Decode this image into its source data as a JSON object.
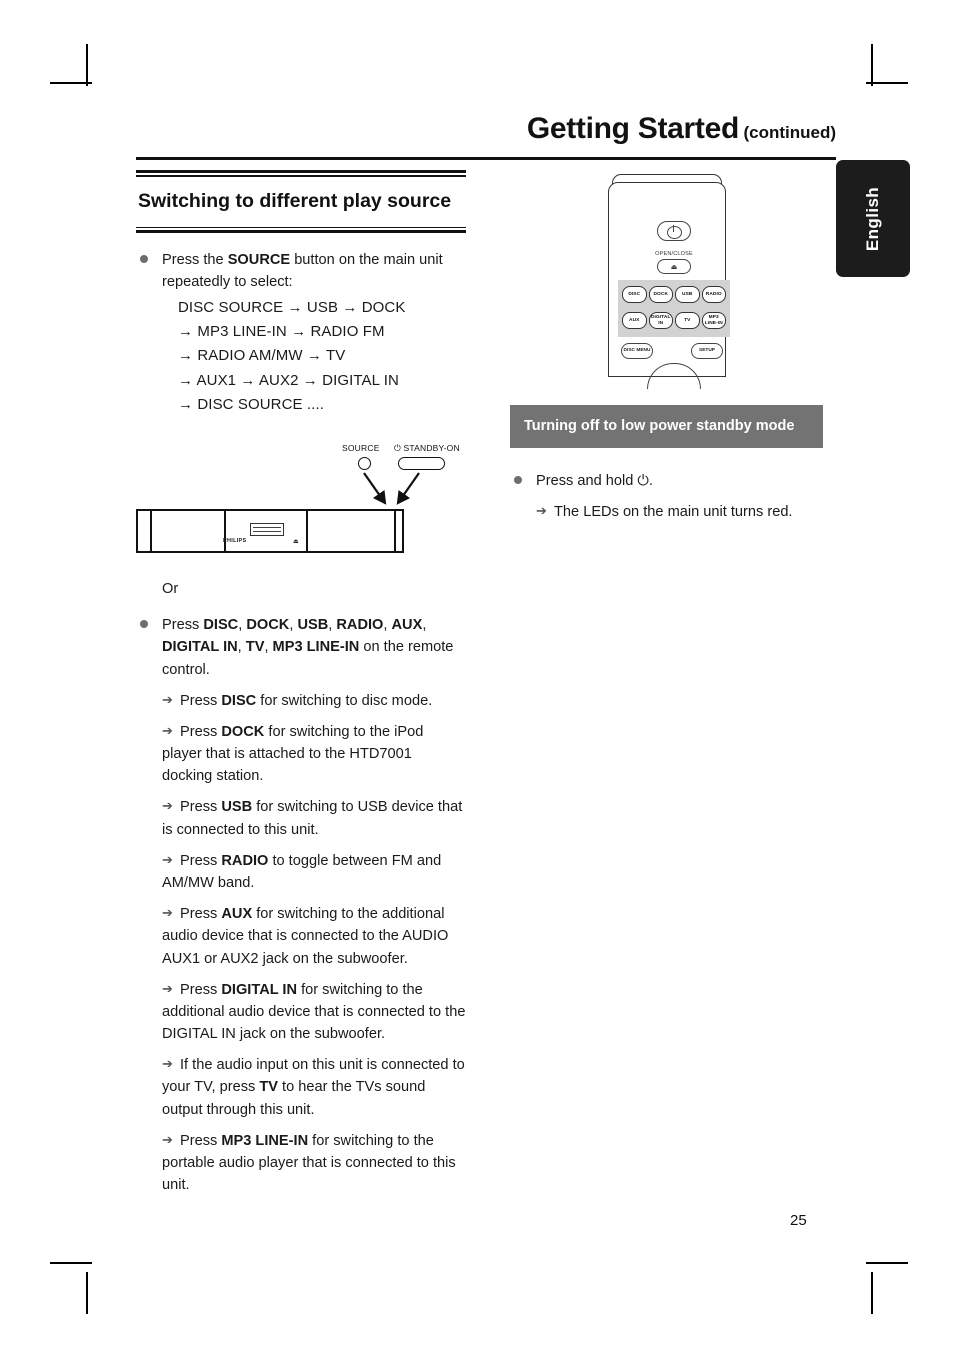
{
  "header": {
    "title": "Getting Started",
    "continued": "(continued)"
  },
  "language_tab": {
    "label": "English"
  },
  "left_column": {
    "section_heading": "Switching to different play source",
    "source_instruction_pre": "Press the ",
    "source_instruction_bold": "SOURCE",
    "source_instruction_post": " button on the main unit repeatedly to select:",
    "source_sequence": [
      "DISC SOURCE → USB → DOCK",
      "→ MP3 LINE-IN → RADIO FM",
      "→ RADIO AM/MW → TV",
      "→ AUX1 → AUX2 → DIGITAL IN",
      "→ DISC SOURCE ...."
    ],
    "unit_figure": {
      "source_label": "SOURCE",
      "standby_label": "⏻ STANDBY-ON",
      "brand": "PHILIPS",
      "eject_mark": "⏏"
    },
    "or_text": "Or",
    "remote_intro": {
      "pre": "Press ",
      "keys": [
        "DISC",
        "DOCK",
        "USB",
        "RADIO",
        "AUX",
        "DIGITAL IN",
        "TV",
        "MP3 LINE-IN"
      ],
      "post": " on the remote control."
    },
    "arrow_items": [
      {
        "pre": "Press ",
        "key": "DISC",
        "post": " for switching to disc mode."
      },
      {
        "pre": "Press ",
        "key": "DOCK",
        "post": " for switching to the iPod player that is attached to the HTD7001 docking station."
      },
      {
        "pre": "Press ",
        "key": "USB",
        "post": " for switching to USB device that is connected to this unit."
      },
      {
        "pre": "Press ",
        "key": "RADIO",
        "post": " to toggle between FM and AM/MW band."
      },
      {
        "pre": "Press ",
        "key": "AUX",
        "post": " for switching to the additional audio device that is connected to the AUDIO AUX1 or AUX2 jack on the subwoofer."
      },
      {
        "pre": "Press ",
        "key": "DIGITAL IN",
        "post": " for switching to the additional audio device that is connected to the DIGITAL IN jack on the subwoofer."
      },
      {
        "pre": "If the audio input on this unit is connected to your TV, press ",
        "key": "TV",
        "post": " to hear the TVs sound output through this unit."
      },
      {
        "pre": "Press ",
        "key": "MP3 LINE-IN",
        "post": " for switching to the portable audio player that is connected to this unit."
      }
    ]
  },
  "right_column": {
    "remote_figure": {
      "open_close_label": "OPEN/CLOSE",
      "eject_glyph": "⏏",
      "source_keys_row1": [
        "DISC",
        "DOCK",
        "USB",
        "RADIO"
      ],
      "source_keys_row2": [
        "AUX",
        "DIGITAL IN",
        "TV",
        "MP3 LINE-IN"
      ],
      "disc_menu_label": "DISC MENU",
      "setup_label": "SETUP"
    },
    "callout_heading": "Turning off to low power standby mode",
    "standby_instruction_pre": "Press and hold ",
    "standby_instruction_icon": "⏻",
    "standby_instruction_post": ".",
    "standby_result": "The LEDs on the main unit turns red."
  },
  "footer": {
    "page_number": "25"
  },
  "colors": {
    "callout_background": "#737373",
    "tab_background": "#1c1c1c",
    "bullet": "#6e6e6e",
    "remote_panel": "#d2d2d2"
  }
}
